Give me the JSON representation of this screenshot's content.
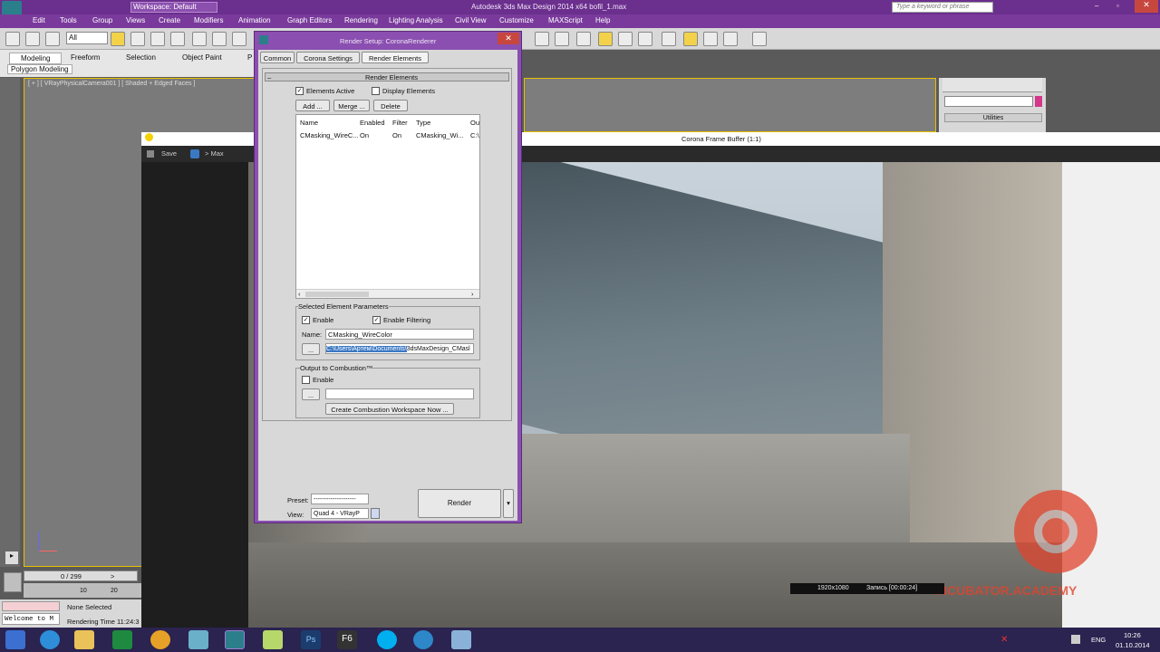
{
  "app": {
    "title": "Autodesk 3ds Max Design 2014 x64     bofil_1.max",
    "workspace": "Workspace: Default",
    "search_placeholder": "Type a keyword or phrase"
  },
  "menu": [
    "Edit",
    "Tools",
    "Group",
    "Views",
    "Create",
    "Modifiers",
    "Animation",
    "Graph Editors",
    "Rendering",
    "Lighting Analysis",
    "Civil View",
    "Customize",
    "MAXScript",
    "Help"
  ],
  "toolbar": {
    "selection_filter": "All"
  },
  "ribbon": {
    "tabs": [
      "Modeling",
      "Freeform",
      "Selection",
      "Object Paint",
      "P"
    ],
    "sub": "Polygon Modeling"
  },
  "viewport": {
    "label": "[ + ] [ VRayPhysicalCamera001 ] [ Shaded + Edged Faces ]"
  },
  "timeline": {
    "counter": "0 / 299",
    "ticks": [
      "10",
      "20"
    ]
  },
  "status": {
    "selection": "None Selected",
    "render_time": "Rendering Time 11:24:3",
    "maxscript": "Welcome to M"
  },
  "command_panel": {
    "utilities": "Utilities"
  },
  "frame_buffer": {
    "title": "Corona Frame Buffer (1:1)",
    "save": "Save",
    "to_max": "> Max",
    "resolution": "1920x1080",
    "record": "Запись [00:00:24]",
    "watermark": "INCUBATOR.ACADEMY",
    "brand_color": "#e0442e"
  },
  "dialog": {
    "title": "Render Setup: CoronaRenderer",
    "tabs": [
      "Common",
      "Corona Settings",
      "Render Elements"
    ],
    "rollout": "Render Elements",
    "elements_active": "Elements Active",
    "display_elements": "Display Elements",
    "add": "Add ...",
    "merge": "Merge ...",
    "delete": "Delete",
    "columns": [
      "Name",
      "Enabled",
      "Filter",
      "Type",
      "Ou"
    ],
    "row": [
      "CMasking_WireC...",
      "On",
      "On",
      "CMasking_Wi...",
      "C:\\"
    ],
    "sel_group": "Selected Element Parameters",
    "enable": "Enable",
    "enable_filtering": "Enable Filtering",
    "name_label": "Name:",
    "name_value": "CMasking_WireColor",
    "path_selected": "C:\\Users\\Артем\\Documents\\",
    "path_rest": "3dsMaxDesign_CMasl",
    "browse": "...",
    "comb_group": "Output to Combustion™",
    "comb_enable": "Enable",
    "create_ws": "Create Combustion Workspace Now ...",
    "preset_label": "Preset:",
    "preset_value": "--------------------",
    "view_label": "View:",
    "view_value": "Quad 4 - VRayP",
    "render": "Render"
  },
  "tray": {
    "lang": "ENG",
    "time": "10:26",
    "date": "01.10.2014"
  },
  "colors": {
    "titlebar": "#6b2f8e",
    "menubar": "#7a3a9c",
    "accent": "#e8c000",
    "taskbar": "#2b2350"
  }
}
